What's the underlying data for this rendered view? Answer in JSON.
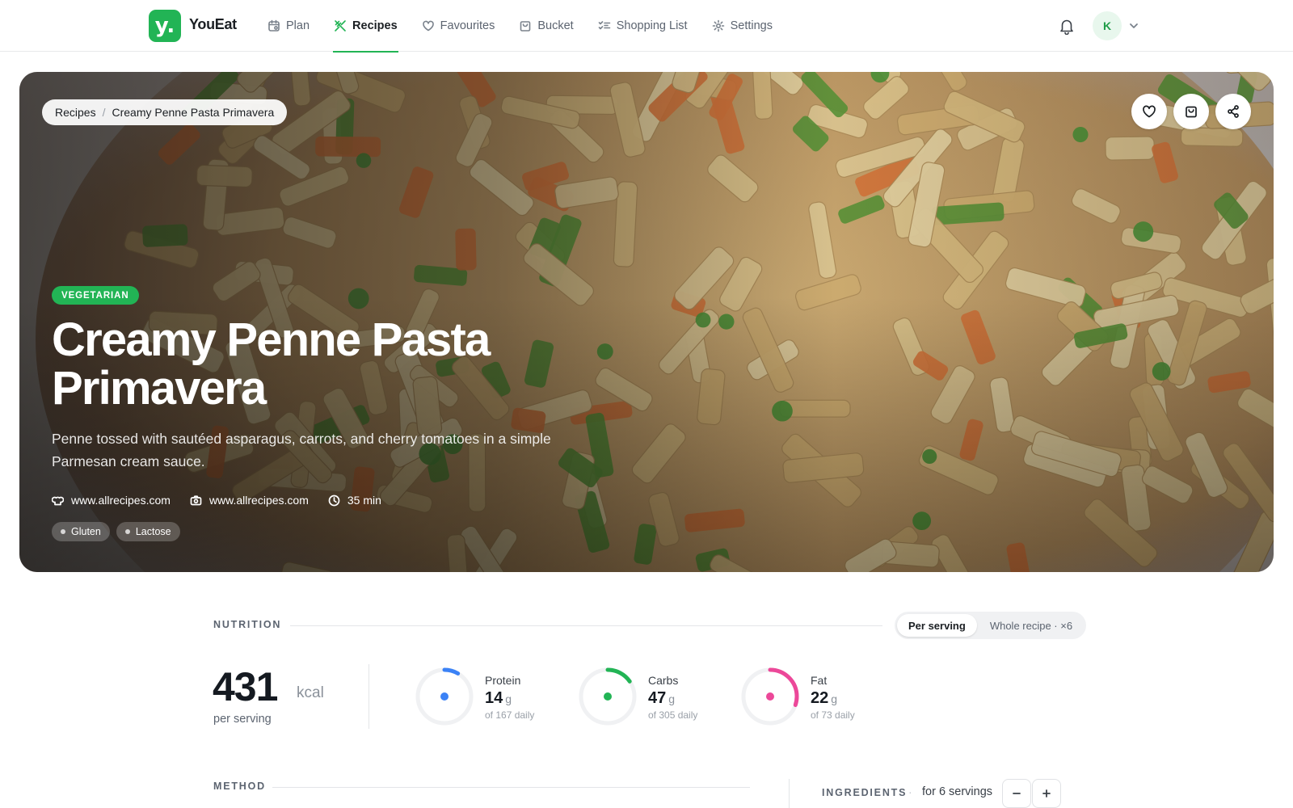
{
  "app": {
    "name": "YouEat",
    "logo_letter": "y."
  },
  "nav": {
    "items": [
      {
        "label": "Plan",
        "icon": "calendar-icon",
        "active": false
      },
      {
        "label": "Recipes",
        "icon": "utensils-icon",
        "active": true
      },
      {
        "label": "Favourites",
        "icon": "heart-icon",
        "active": false
      },
      {
        "label": "Bucket",
        "icon": "bag-icon",
        "active": false
      },
      {
        "label": "Shopping List",
        "icon": "checklist-icon",
        "active": false
      },
      {
        "label": "Settings",
        "icon": "gear-icon",
        "active": false
      }
    ],
    "accent_color": "#22b455"
  },
  "user": {
    "avatar_initial": "K"
  },
  "breadcrumb": {
    "parent": "Recipes",
    "separator": "/",
    "current": "Creamy Penne Pasta Primavera"
  },
  "recipe": {
    "tag": "VEGETARIAN",
    "title_line1": "Creamy Penne Pasta",
    "title_line2": "Primavera",
    "description_line1": "Penne tossed with sautéed asparagus, carrots, and cherry tomatoes in a simple",
    "description_line2": "Parmesan cream sauce.",
    "source": "www.allrecipes.com",
    "photo_credit": "www.allrecipes.com",
    "time": "35 min",
    "allergens": [
      "Gluten",
      "Lactose"
    ]
  },
  "nutrition": {
    "section_label": "NUTRITION",
    "toggle": {
      "per_serving": "Per serving",
      "whole_recipe": "Whole recipe · ×6",
      "selected": "per_serving"
    },
    "kcal": {
      "value": "431",
      "unit": "kcal",
      "caption": "per serving"
    },
    "macros": [
      {
        "name": "Protein",
        "value": "14",
        "unit": "g",
        "daily": "of 167 daily",
        "fraction": 0.084,
        "color": "#3b82f6"
      },
      {
        "name": "Carbs",
        "value": "47",
        "unit": "g",
        "daily": "of 305 daily",
        "fraction": 0.154,
        "color": "#22b455"
      },
      {
        "name": "Fat",
        "value": "22",
        "unit": "g",
        "daily": "of 73 daily",
        "fraction": 0.301,
        "color": "#ec4899"
      }
    ]
  },
  "method": {
    "section_label": "METHOD"
  },
  "ingredients": {
    "section_label": "INGREDIENTS",
    "dot": "·",
    "servings": "for 6 servings"
  }
}
